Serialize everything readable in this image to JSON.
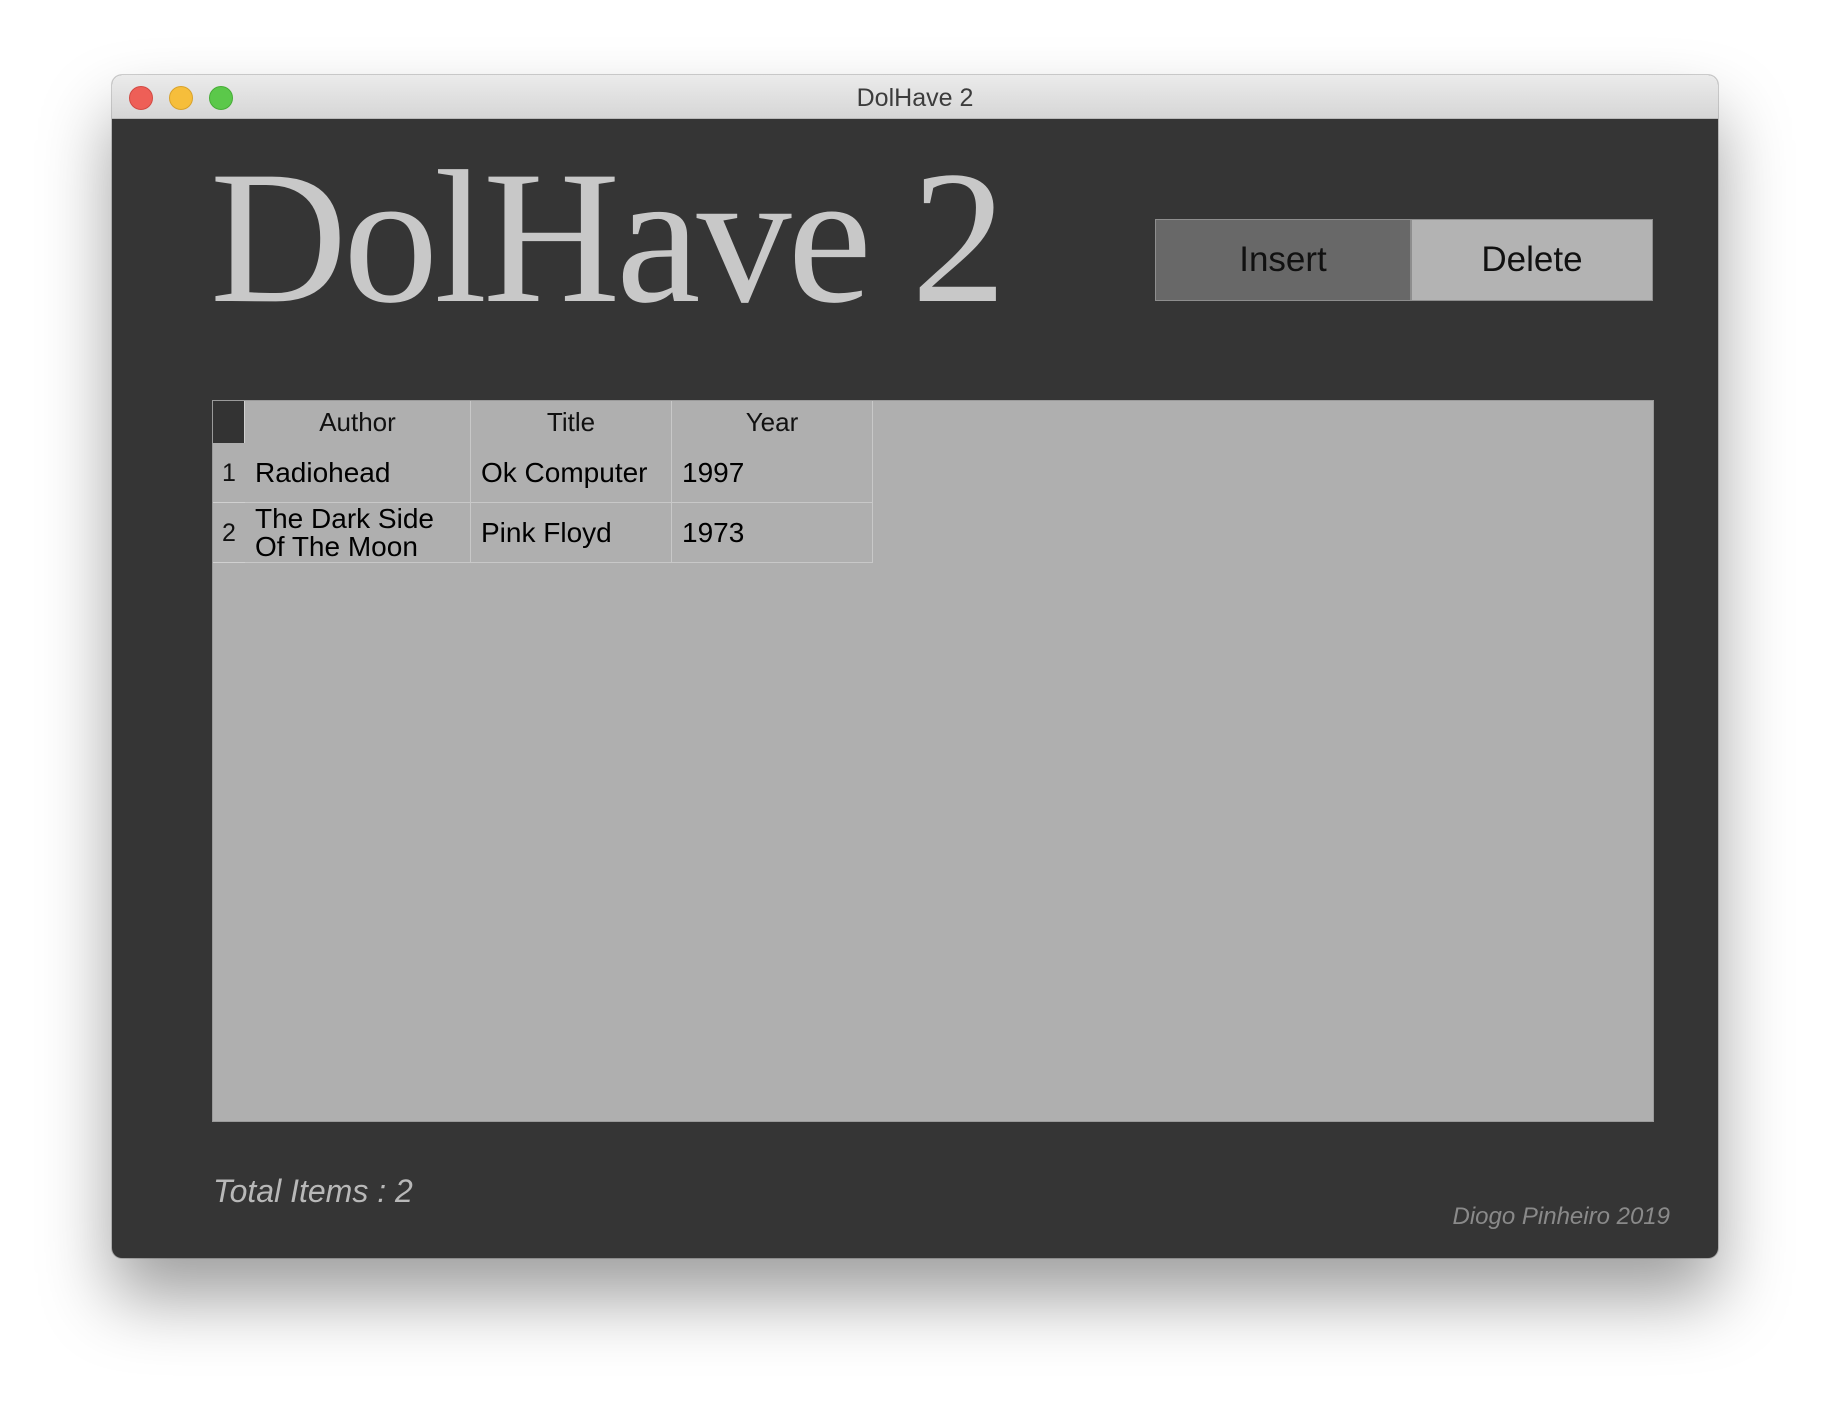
{
  "window": {
    "title": "DolHave 2"
  },
  "header": {
    "logo": "DolHave 2"
  },
  "toolbar": {
    "insert_label": "Insert",
    "delete_label": "Delete"
  },
  "table": {
    "columns": [
      "Author",
      "Title",
      "Year"
    ],
    "rows": [
      {
        "index": "1",
        "author": "Radiohead",
        "title": "Ok Computer",
        "year": "1997"
      },
      {
        "index": "2",
        "author": "The Dark Side Of The Moon",
        "title": "Pink Floyd",
        "year": "1973"
      }
    ]
  },
  "footer": {
    "total_items": "Total Items : 2",
    "credit": "Diogo Pinheiro 2019"
  },
  "colors": {
    "window_bg": "#353535",
    "table_bg": "#afafaf",
    "insert_button": "#686868",
    "delete_button": "#b3b3b3",
    "close_button": "#ee5f57",
    "minimize_button": "#f6be3b",
    "maximize_button": "#5bc84a"
  }
}
